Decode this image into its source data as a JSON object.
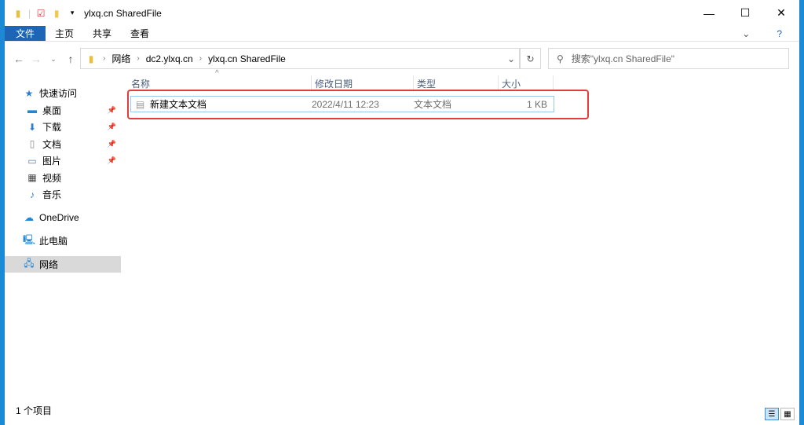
{
  "window": {
    "title": "ylxq.cn SharedFile",
    "minimize": "—",
    "maximize": "☐",
    "close": "✕"
  },
  "ribbon": {
    "tabs": [
      "文件",
      "主页",
      "共享",
      "查看"
    ],
    "expand": "⌄",
    "help": "?"
  },
  "address": {
    "crumbs": [
      "网络",
      "dc2.ylxq.cn",
      "ylxq.cn SharedFile"
    ]
  },
  "search": {
    "placeholder": "搜索\"ylxq.cn SharedFile\""
  },
  "sidebar": {
    "quick_access": "快速访问",
    "items": [
      {
        "label": "桌面",
        "pinned": true
      },
      {
        "label": "下载",
        "pinned": true
      },
      {
        "label": "文档",
        "pinned": true
      },
      {
        "label": "图片",
        "pinned": true
      },
      {
        "label": "视频"
      },
      {
        "label": "音乐"
      }
    ],
    "onedrive": "OneDrive",
    "this_pc": "此电脑",
    "network": "网络"
  },
  "columns": [
    "名称",
    "修改日期",
    "类型",
    "大小"
  ],
  "files": [
    {
      "name": "新建文本文档",
      "modified": "2022/4/11 12:23",
      "type": "文本文档",
      "size": "1 KB"
    }
  ],
  "status": "1 个项目"
}
